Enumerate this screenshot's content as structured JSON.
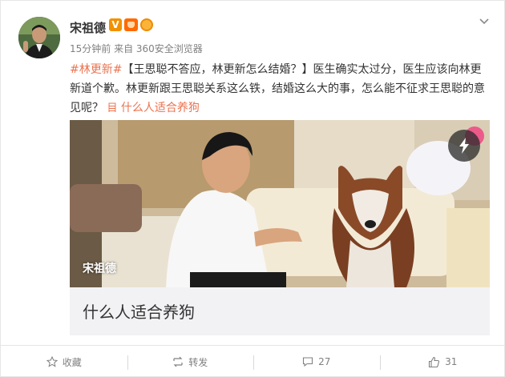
{
  "user": {
    "name": "宋祖德"
  },
  "meta": {
    "text": "15分钟前 来自 360安全浏览器"
  },
  "post": {
    "tag": "#林更新#",
    "body": "【王思聪不答应，林更新怎么结婚？】医生确实太过分，医生应该向林更新道个歉。林更新跟王思聪关系这么铁，结婚这么大的事，怎么能不征求王思聪的意见呢？",
    "link_icon": "目",
    "link_text": "什么人适合养狗"
  },
  "media": {
    "watermark": "宋祖德",
    "title": "什么人适合养狗"
  },
  "actions": {
    "favorite": "收藏",
    "repost": "转发",
    "comment": "27",
    "like": "31"
  },
  "colors": {
    "accent": "#eb7350",
    "meta": "#808080",
    "title_bar": "#f2f2f5"
  }
}
